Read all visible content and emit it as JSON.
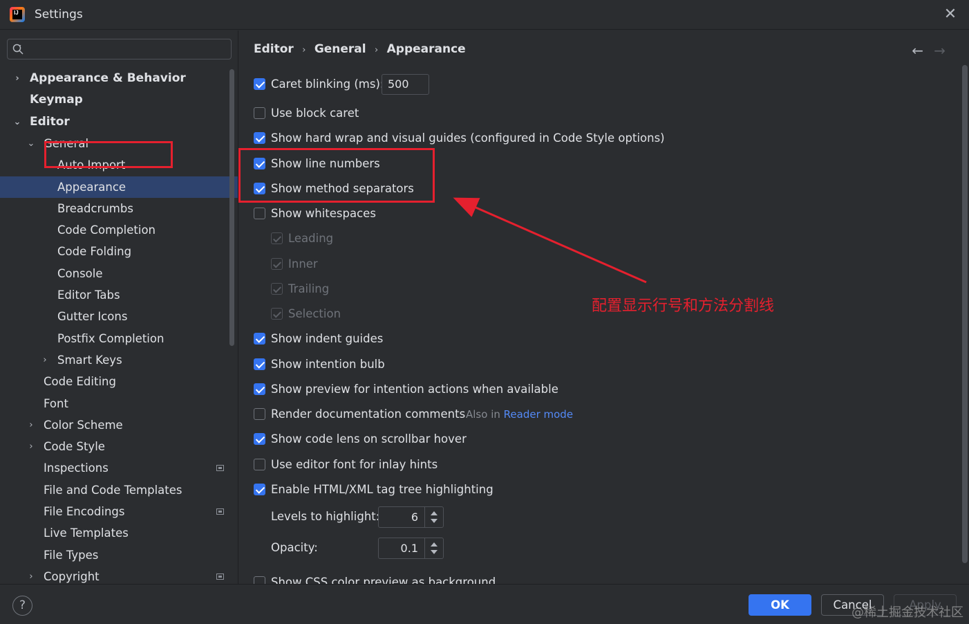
{
  "window": {
    "title": "Settings",
    "logo_text": "IJ"
  },
  "search": {
    "value": "",
    "placeholder": ""
  },
  "sidebar": {
    "items": [
      {
        "label": "Appearance & Behavior",
        "level": 0,
        "arrow": "›",
        "bold": true,
        "selected": false,
        "icon": ""
      },
      {
        "label": "Keymap",
        "level": 0,
        "arrow": "",
        "bold": true,
        "selected": false,
        "icon": ""
      },
      {
        "label": "Editor",
        "level": 0,
        "arrow": "⌄",
        "bold": true,
        "selected": false,
        "icon": ""
      },
      {
        "label": "General",
        "level": 1,
        "arrow": "⌄",
        "bold": false,
        "selected": false,
        "icon": ""
      },
      {
        "label": "Auto Import",
        "level": 2,
        "arrow": "",
        "bold": false,
        "selected": false,
        "icon": ""
      },
      {
        "label": "Appearance",
        "level": 2,
        "arrow": "",
        "bold": false,
        "selected": true,
        "icon": ""
      },
      {
        "label": "Breadcrumbs",
        "level": 2,
        "arrow": "",
        "bold": false,
        "selected": false,
        "icon": ""
      },
      {
        "label": "Code Completion",
        "level": 2,
        "arrow": "",
        "bold": false,
        "selected": false,
        "icon": ""
      },
      {
        "label": "Code Folding",
        "level": 2,
        "arrow": "",
        "bold": false,
        "selected": false,
        "icon": ""
      },
      {
        "label": "Console",
        "level": 2,
        "arrow": "",
        "bold": false,
        "selected": false,
        "icon": ""
      },
      {
        "label": "Editor Tabs",
        "level": 2,
        "arrow": "",
        "bold": false,
        "selected": false,
        "icon": ""
      },
      {
        "label": "Gutter Icons",
        "level": 2,
        "arrow": "",
        "bold": false,
        "selected": false,
        "icon": ""
      },
      {
        "label": "Postfix Completion",
        "level": 2,
        "arrow": "",
        "bold": false,
        "selected": false,
        "icon": ""
      },
      {
        "label": "Smart Keys",
        "level": 2,
        "arrow": "›",
        "bold": false,
        "selected": false,
        "icon": ""
      },
      {
        "label": "Code Editing",
        "level": 1,
        "arrow": "",
        "bold": false,
        "selected": false,
        "icon": ""
      },
      {
        "label": "Font",
        "level": 1,
        "arrow": "",
        "bold": false,
        "selected": false,
        "icon": ""
      },
      {
        "label": "Color Scheme",
        "level": 1,
        "arrow": "›",
        "bold": false,
        "selected": false,
        "icon": ""
      },
      {
        "label": "Code Style",
        "level": 1,
        "arrow": "›",
        "bold": false,
        "selected": false,
        "icon": ""
      },
      {
        "label": "Inspections",
        "level": 1,
        "arrow": "",
        "bold": false,
        "selected": false,
        "icon": "project-settings-icon"
      },
      {
        "label": "File and Code Templates",
        "level": 1,
        "arrow": "",
        "bold": false,
        "selected": false,
        "icon": ""
      },
      {
        "label": "File Encodings",
        "level": 1,
        "arrow": "",
        "bold": false,
        "selected": false,
        "icon": "project-settings-icon"
      },
      {
        "label": "Live Templates",
        "level": 1,
        "arrow": "",
        "bold": false,
        "selected": false,
        "icon": ""
      },
      {
        "label": "File Types",
        "level": 1,
        "arrow": "",
        "bold": false,
        "selected": false,
        "icon": ""
      },
      {
        "label": "Copyright",
        "level": 1,
        "arrow": "›",
        "bold": false,
        "selected": false,
        "icon": "project-settings-icon"
      }
    ]
  },
  "breadcrumb": {
    "items": [
      "Editor",
      "General",
      "Appearance"
    ],
    "separator": "›"
  },
  "nav": {
    "back": "←",
    "forward": "→"
  },
  "options": {
    "caret_blinking": {
      "label": "Caret blinking (ms):",
      "checked": true,
      "value": "500"
    },
    "block_caret": {
      "label": "Use block caret",
      "checked": false
    },
    "hard_wrap": {
      "label": "Show hard wrap and visual guides (configured in Code Style options)",
      "checked": true
    },
    "line_numbers": {
      "label": "Show line numbers",
      "checked": true
    },
    "method_separators": {
      "label": "Show method separators",
      "checked": true
    },
    "whitespaces": {
      "label": "Show whitespaces",
      "checked": false
    },
    "leading": {
      "label": "Leading",
      "checked": true,
      "disabled": true
    },
    "inner": {
      "label": "Inner",
      "checked": true,
      "disabled": true
    },
    "trailing": {
      "label": "Trailing",
      "checked": true,
      "disabled": true
    },
    "selection": {
      "label": "Selection",
      "checked": true,
      "disabled": true
    },
    "indent_guides": {
      "label": "Show indent guides",
      "checked": true
    },
    "intention_bulb": {
      "label": "Show intention bulb",
      "checked": true
    },
    "intention_preview": {
      "label": "Show preview for intention actions when available",
      "checked": true
    },
    "render_docs": {
      "label": "Render documentation comments",
      "checked": false,
      "hint_prefix": "Also in",
      "hint_link": "Reader mode"
    },
    "code_lens": {
      "label": "Show code lens on scrollbar hover",
      "checked": true
    },
    "editor_font_inlay": {
      "label": "Use editor font for inlay hints",
      "checked": false
    },
    "tag_tree": {
      "label": "Enable HTML/XML tag tree highlighting",
      "checked": true
    },
    "levels": {
      "label": "Levels to highlight:",
      "value": "6"
    },
    "opacity": {
      "label": "Opacity:",
      "value": "0.1"
    },
    "css_color": {
      "label": "Show CSS color preview as background",
      "checked": false
    }
  },
  "annotation": {
    "text": "配置显示行号和方法分割线",
    "color": "#e5202e"
  },
  "footer": {
    "help": "?",
    "ok": "OK",
    "cancel": "Cancel",
    "apply": "Apply",
    "watermark": "@稀土掘金技术社区"
  },
  "colors": {
    "accent": "#3574f0",
    "selection": "#2e436e",
    "background": "#2b2d30",
    "highlight_red": "#e5202e",
    "link": "#548af7"
  }
}
